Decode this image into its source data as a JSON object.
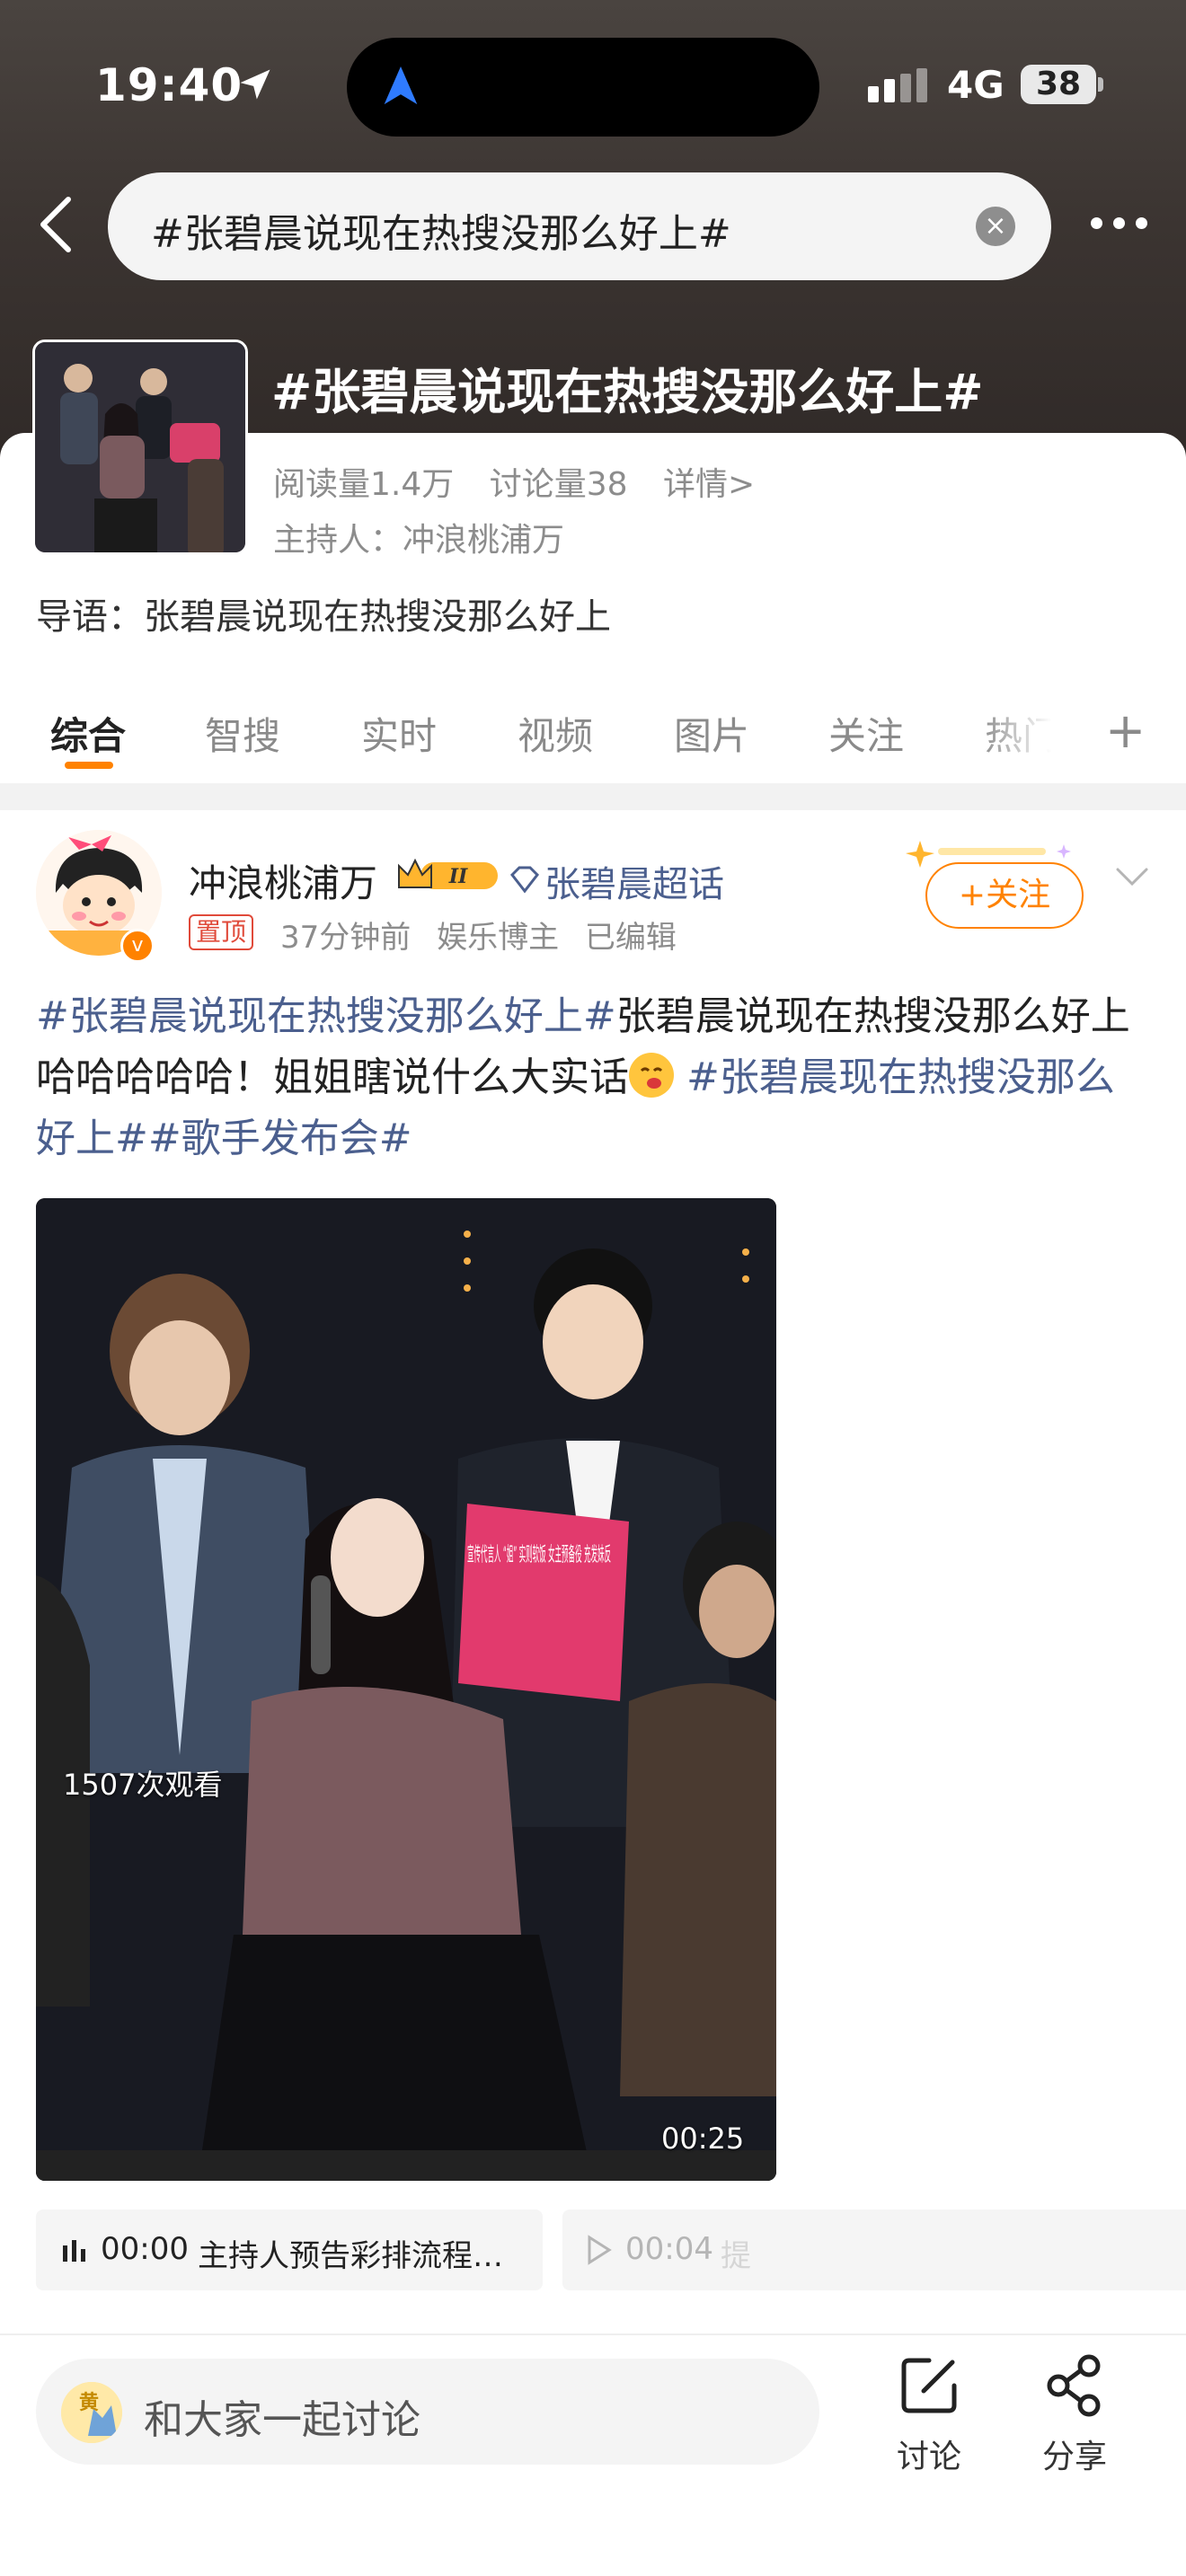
{
  "status_bar": {
    "time": "19:40",
    "network": "4G",
    "battery": "38"
  },
  "search": {
    "query": "#张碧晨说现在热搜没那么好上#"
  },
  "topic": {
    "title": "#张碧晨说现在热搜没那么好上#",
    "reads": "阅读量1.4万",
    "discussions": "讨论量38",
    "details": "详情>",
    "host": "主持人：冲浪桃浦万",
    "intro": "导语：张碧晨说现在热搜没那么好上"
  },
  "tabs": [
    {
      "label": "综合",
      "active": true
    },
    {
      "label": "智搜"
    },
    {
      "label": "实时"
    },
    {
      "label": "视频"
    },
    {
      "label": "图片"
    },
    {
      "label": "关注"
    },
    {
      "label": "热门"
    }
  ],
  "post": {
    "author": "冲浪桃浦万",
    "level_badge": "II",
    "super_topic": "张碧晨超话",
    "pin": "置顶",
    "time": "37分钟前",
    "role": "娱乐博主",
    "edited": "已编辑",
    "follow_label": "+关注",
    "text": {
      "tag1": "#张碧晨说现在热搜没那么好上#",
      "body": "张碧晨说现在热搜没那么好上哈哈哈哈哈！姐姐瞎说什么大实话",
      "tag2": "#张碧晨现在热搜没那么好上#",
      "tag3": "#歌手发布会#"
    },
    "video": {
      "view_count": "1507次观看",
      "duration": "00:25",
      "sign_text": "宣传代言人 “姐” 实则软饭 女主预备役 充发妹反"
    },
    "chapters": [
      {
        "time": "00:00",
        "label": "主持人预告彩排流程…"
      },
      {
        "time": "00:04",
        "label": "提"
      }
    ]
  },
  "bottom_bar": {
    "comment_placeholder": "和大家一起讨论",
    "comment_avatar_text": "黄",
    "discuss_label": "讨论",
    "share_label": "分享"
  },
  "colors": {
    "accent": "#ff8200",
    "link": "#4b5f8e",
    "pin": "#e04a3a"
  }
}
